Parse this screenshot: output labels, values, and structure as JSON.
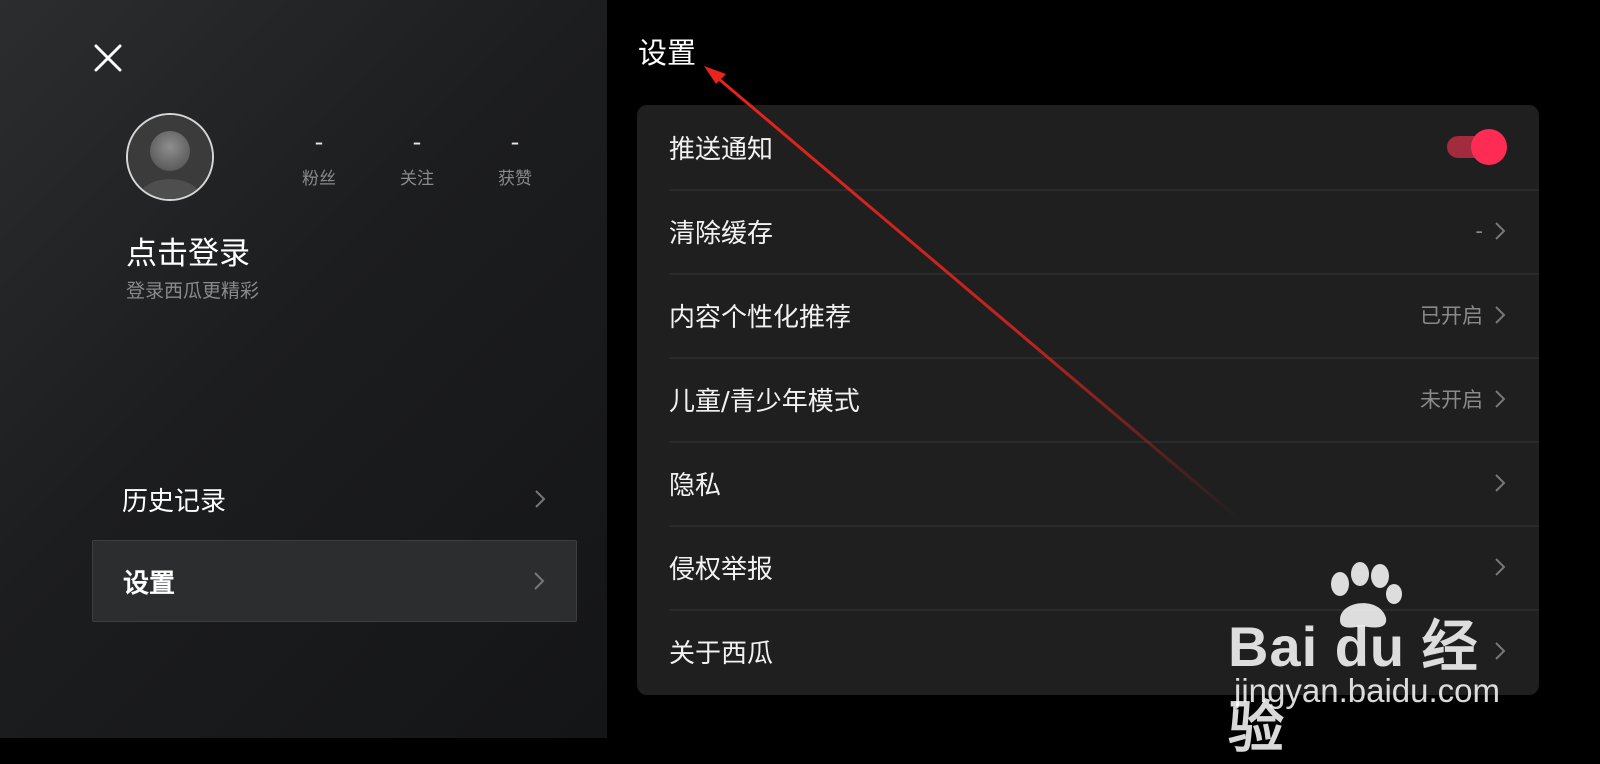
{
  "profile": {
    "stats": [
      {
        "value": "-",
        "label": "粉丝"
      },
      {
        "value": "-",
        "label": "关注"
      },
      {
        "value": "-",
        "label": "获赞"
      }
    ],
    "login_title": "点击登录",
    "login_subtitle": "登录西瓜更精彩"
  },
  "sidebar": {
    "items": [
      {
        "label": "历史记录"
      },
      {
        "label": "设置"
      }
    ]
  },
  "settings": {
    "title": "设置",
    "rows": [
      {
        "label": "推送通知",
        "value": ""
      },
      {
        "label": "清除缓存",
        "value": "-"
      },
      {
        "label": "内容个性化推荐",
        "value": "已开启"
      },
      {
        "label": "儿童/青少年模式",
        "value": "未开启"
      },
      {
        "label": "隐私",
        "value": ""
      },
      {
        "label": "侵权举报",
        "value": ""
      },
      {
        "label": "关于西瓜",
        "value": ""
      }
    ],
    "push_notifications_enabled": true
  },
  "colors": {
    "accent": "#fe2c55",
    "annotation_arrow": "#e8241c"
  },
  "watermark": {
    "brand": "Bai du 经验",
    "url": "jingyan.baidu.com"
  }
}
